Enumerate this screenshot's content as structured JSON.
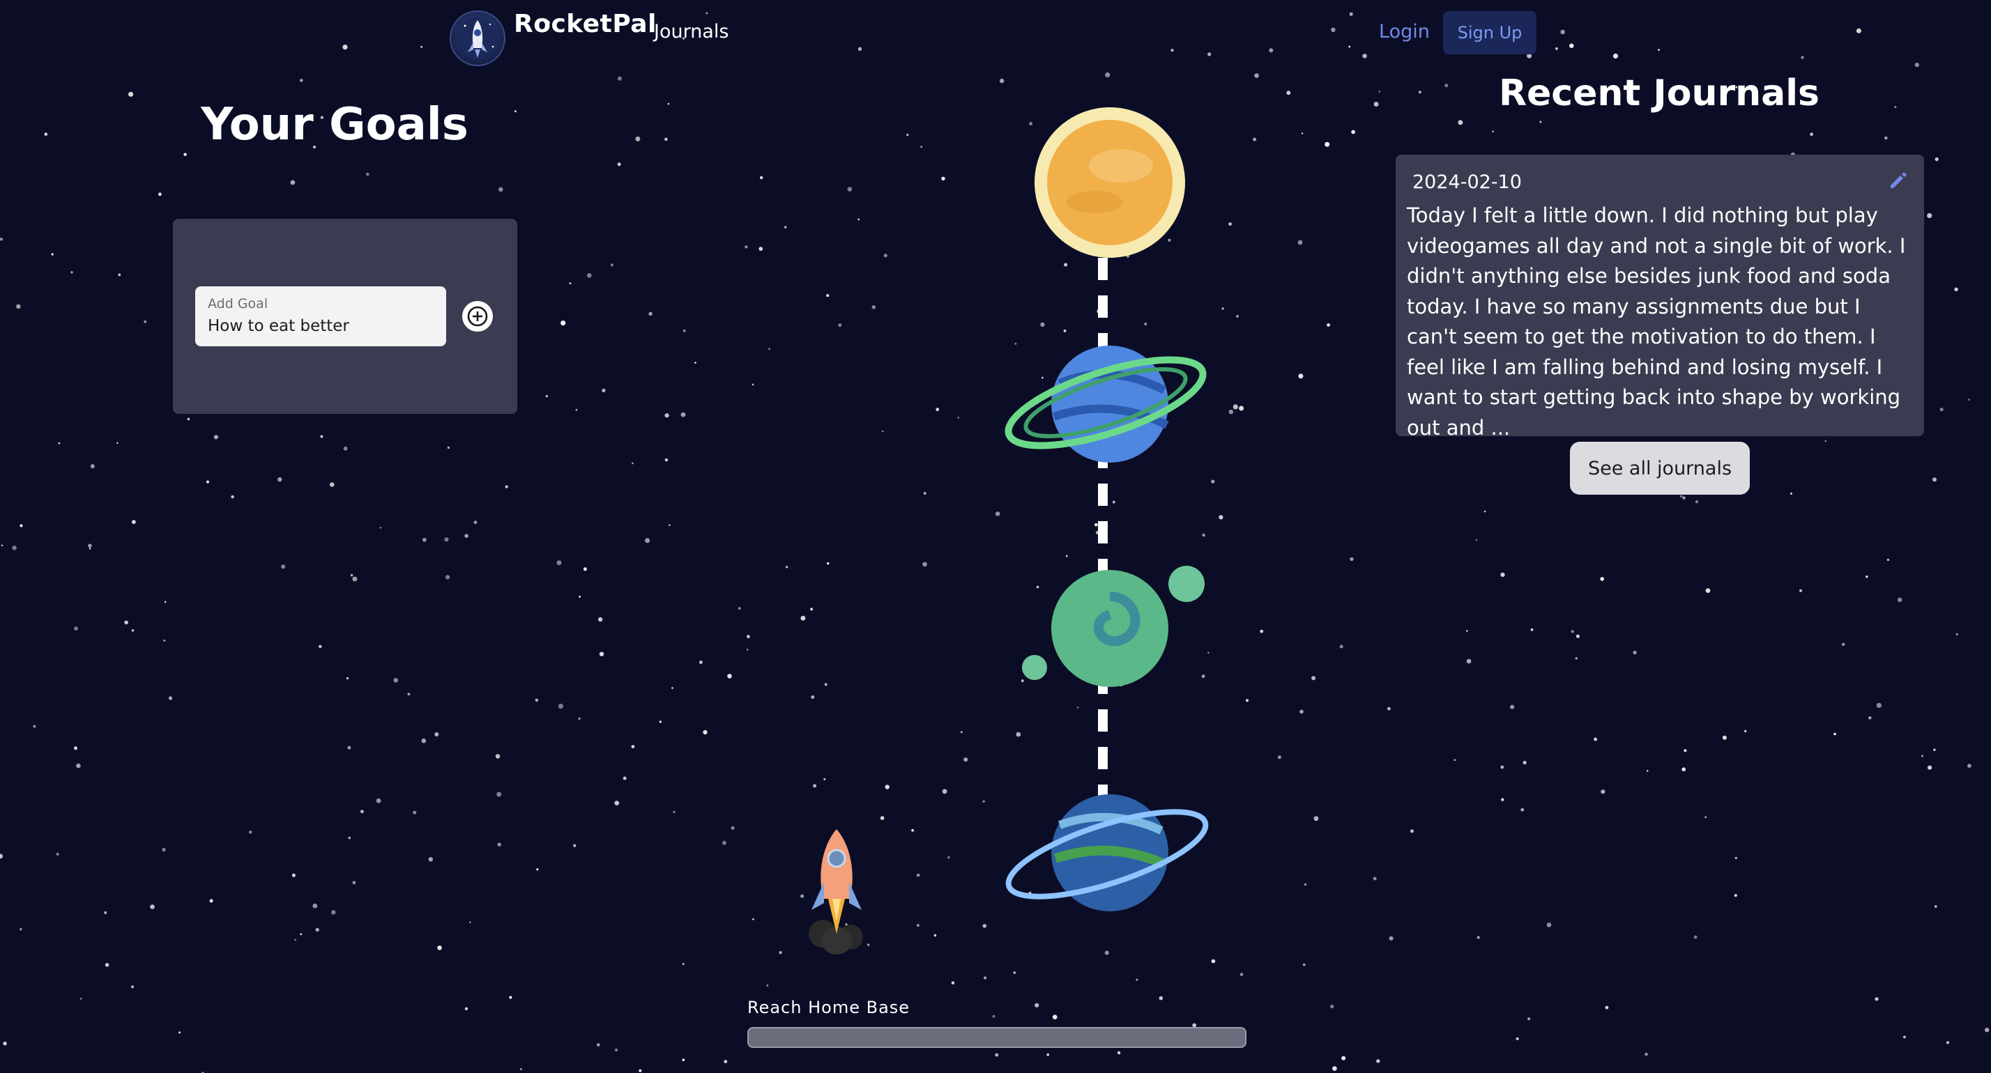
{
  "nav": {
    "brand_name": "RocketPal",
    "links": {
      "journals": "Journals",
      "login": "Login",
      "signup": "Sign Up"
    },
    "logo_icon": "rocket-logo-icon"
  },
  "goals": {
    "title": "Your Goals",
    "add_goal_label": "Add Goal",
    "add_goal_value": "How to eat better",
    "add_icon": "plus-circle-icon"
  },
  "journey": {
    "planets": [
      "sun-planet",
      "blue-ringed-planet",
      "green-moon-planet",
      "earth-ringed-planet"
    ],
    "rocket_icon": "rocket-icon",
    "progress_label": "Reach Home Base",
    "progress_fraction": 0
  },
  "journals": {
    "title": "Recent Journals",
    "entries": [
      {
        "date": "2024-02-10",
        "body": "Today I felt a little down. I did nothing but play videogames all day and not a single bit of work. I didn't anything else besides junk food and soda today. I have so many assignments due but I can't seem to get the motivation to do them. I feel like I am falling behind and losing myself. I want to start getting back into shape by working out and ...",
        "edit_icon": "pencil-icon"
      }
    ],
    "see_all_label": "See all journals"
  },
  "colors": {
    "background": "#0b0d26",
    "panel": "#3b3c51",
    "accent": "#6f8ae8",
    "signup_bg": "#1a2758",
    "progress_track": "#6b6c7c"
  }
}
